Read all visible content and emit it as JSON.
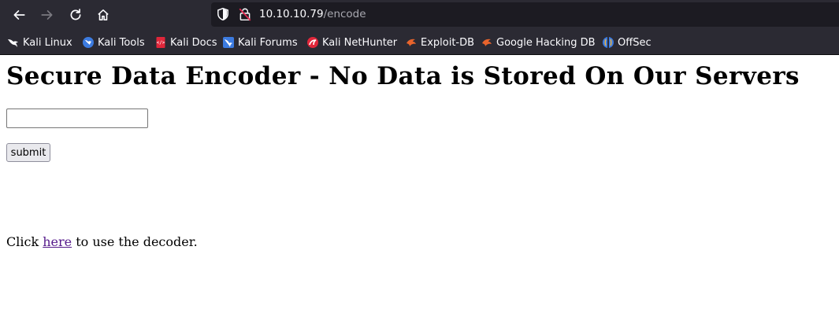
{
  "browser": {
    "url_host": "10.10.10.79",
    "url_path": "/encode",
    "bookmarks": [
      {
        "label": "Kali Linux",
        "icon": "kali-dragon-icon"
      },
      {
        "label": "Kali Tools",
        "icon": "kali-tools-icon"
      },
      {
        "label": "Kali Docs",
        "icon": "kali-docs-icon"
      },
      {
        "label": "Kali Forums",
        "icon": "kali-forums-icon"
      },
      {
        "label": "Kali NetHunter",
        "icon": "kali-nethunter-icon"
      },
      {
        "label": "Exploit-DB",
        "icon": "exploit-db-icon"
      },
      {
        "label": "Google Hacking DB",
        "icon": "ghdb-icon"
      },
      {
        "label": "OffSec",
        "icon": "offsec-icon"
      }
    ]
  },
  "page": {
    "heading": "Secure Data Encoder - No Data is Stored On Our Servers",
    "input_value": "",
    "submit_label": "submit",
    "decoder_prefix": "Click ",
    "decoder_link": "here",
    "decoder_suffix": " to use the decoder."
  },
  "colors": {
    "toolbar_bg": "#2b2a33",
    "urlbar_bg": "#1c1b22",
    "link_visited": "#551a8b"
  }
}
